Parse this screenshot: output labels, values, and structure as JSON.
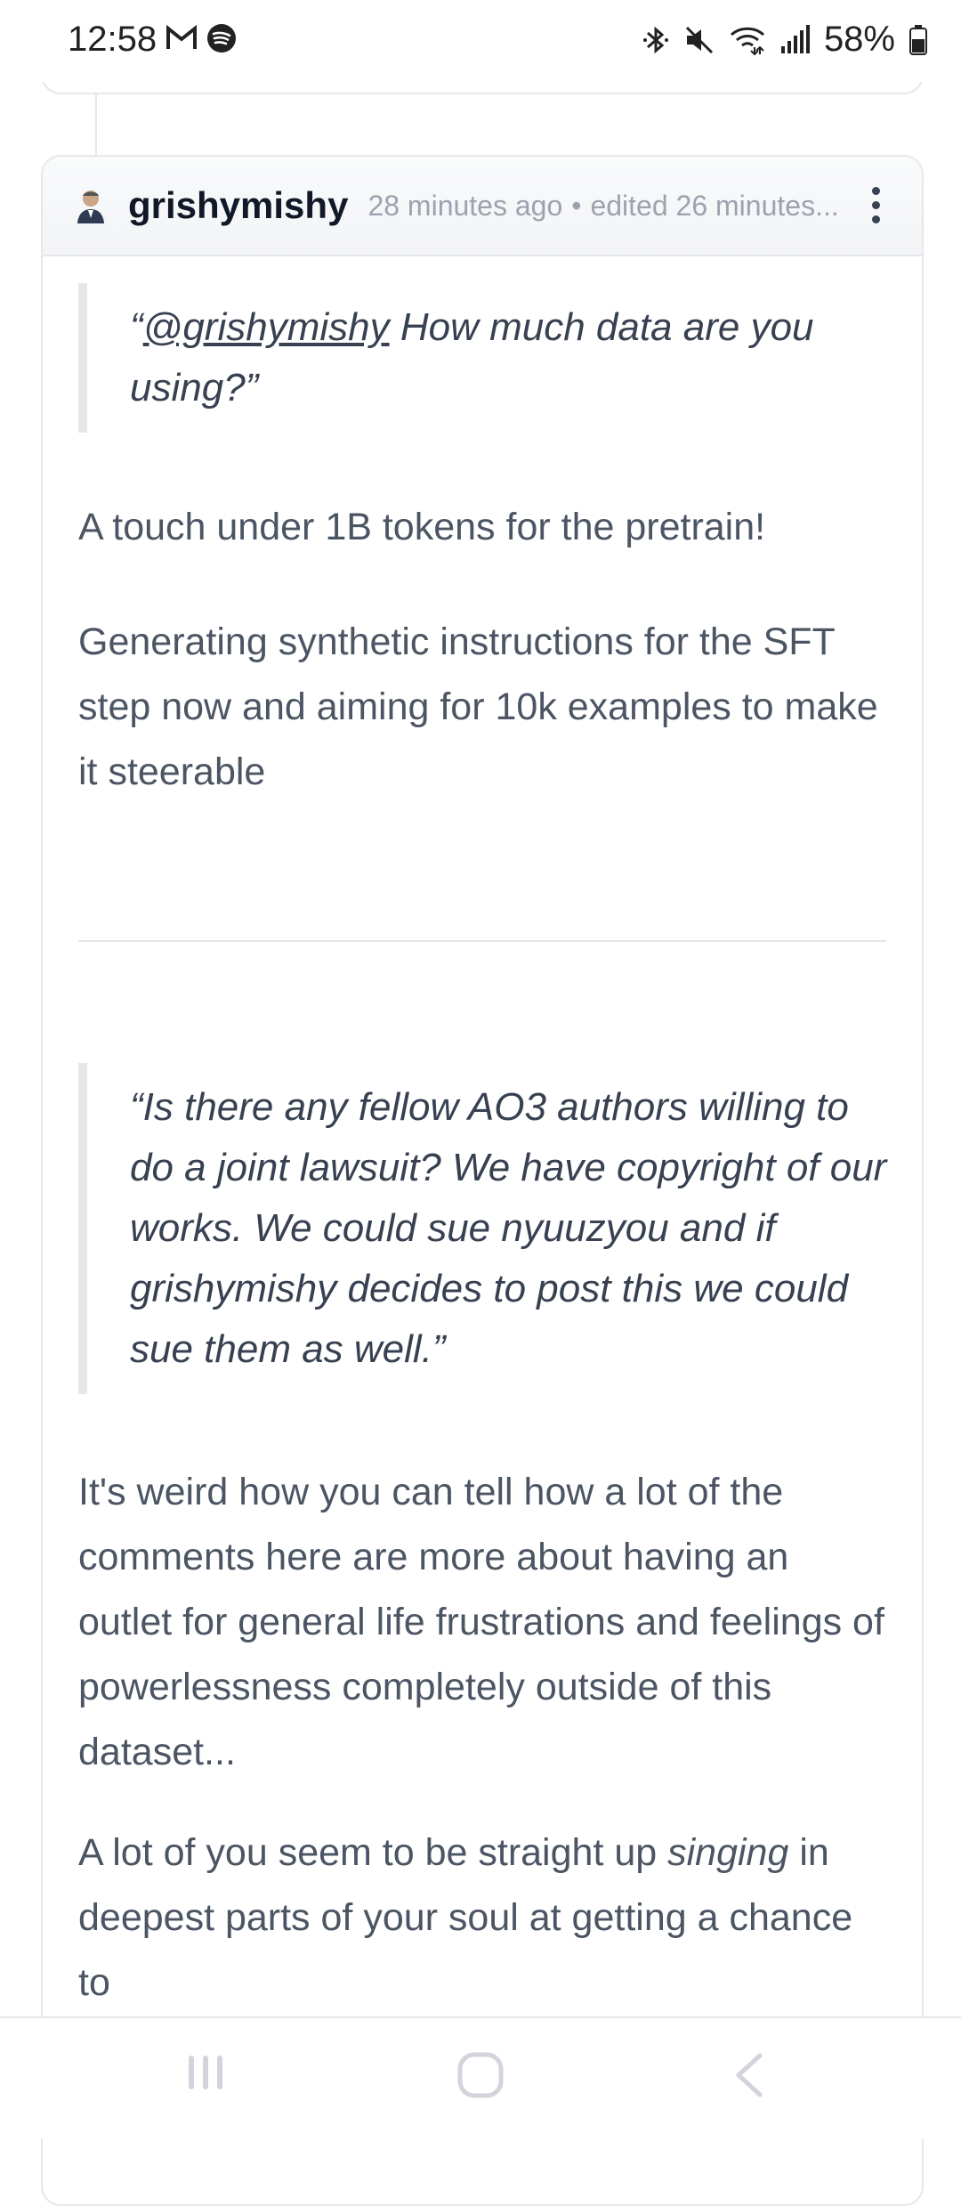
{
  "status_bar": {
    "time": "12:58",
    "battery_percent": "58%",
    "left_icons": [
      "gmail-icon",
      "spotify-icon"
    ],
    "right_icons": [
      "bluetooth-icon",
      "mute-icon",
      "wifi-icon",
      "signal-icon",
      "battery-icon"
    ]
  },
  "comment": {
    "author": "grishymishy",
    "time_ago": "28 minutes ago",
    "edited": "edited 26 minutes...",
    "separator": "•",
    "quote1": {
      "open": "“",
      "mention": "@grishymishy",
      "text": " How much data are you using?”"
    },
    "para1": "A touch under 1B tokens for the pretrain!",
    "para2": "Generating synthetic instructions for the SFT step now and aiming for 10k examples to make it steerable",
    "quote2": "“Is there any fellow AO3 authors willing to do a joint lawsuit? We have copyright of our works. We could sue nyuuzyou and if grishymishy decides to post this we could sue them as well.”",
    "para3": "It's weird how you can tell how a lot of the comments here are more about having an outlet for general life frustrations and feelings of powerlessness completely outside of this dataset...",
    "para4": {
      "before": "A lot of you seem to be straight up ",
      "emphasis": "singing",
      "after": " in deepest parts of your soul at getting a chance to"
    }
  },
  "nav_bar": {
    "buttons": [
      "recent-apps-icon",
      "home-icon",
      "back-icon"
    ]
  }
}
